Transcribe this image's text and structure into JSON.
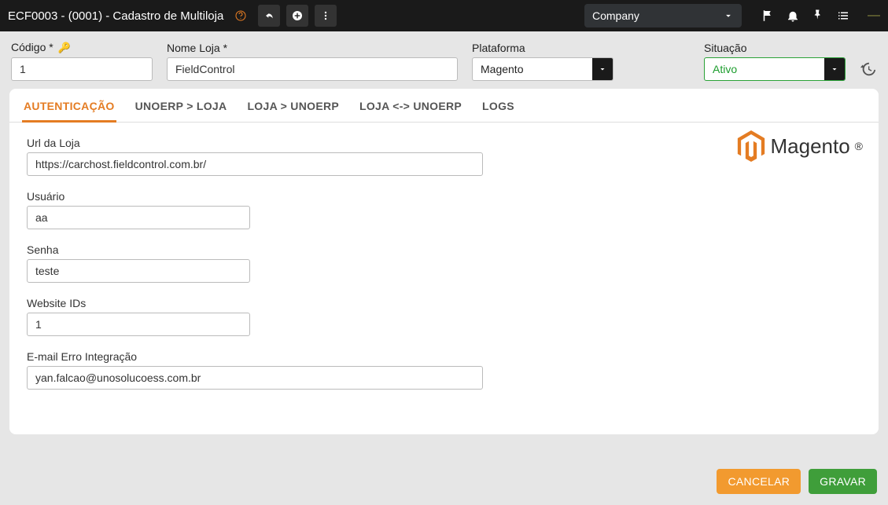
{
  "header": {
    "title": "ECF0003 - (0001) - Cadastro de Multiloja",
    "company": "Company"
  },
  "fields": {
    "codigo_label": "Código *",
    "codigo_value": "1",
    "nomeloja_label": "Nome Loja *",
    "nomeloja_value": "FieldControl",
    "plataforma_label": "Plataforma",
    "plataforma_value": "Magento",
    "situacao_label": "Situação",
    "situacao_value": "Ativo"
  },
  "tabs": {
    "autenticacao": "AUTENTICAÇÃO",
    "unoerp_loja": "UNOERP > LOJA",
    "loja_unoerp": "LOJA > UNOERP",
    "loja_bi": "LOJA <-> UNOERP",
    "logs": "LOGS"
  },
  "auth": {
    "url_label": "Url da Loja",
    "url_value": "https://carchost.fieldcontrol.com.br/",
    "usuario_label": "Usuário",
    "usuario_value": "aa",
    "senha_label": "Senha",
    "senha_value": "teste",
    "website_label": "Website IDs",
    "website_value": "1",
    "email_label": "E-mail Erro Integração",
    "email_value": "yan.falcao@unosolucoess.com.br"
  },
  "logo": {
    "text": "Magento"
  },
  "buttons": {
    "cancel": "CANCELAR",
    "save": "GRAVAR"
  }
}
